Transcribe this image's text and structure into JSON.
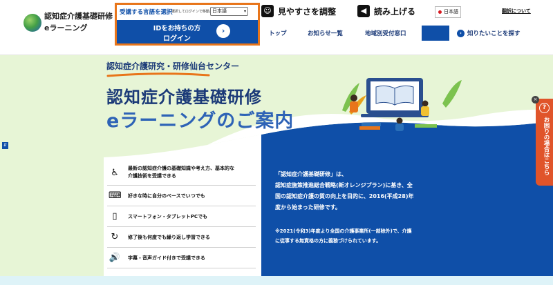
{
  "header": {
    "site_title_line1": "認知症介護基礎研修",
    "site_title_line2": "eラーニング",
    "login": {
      "language_label": "受講する言語を選択",
      "language_hint": "選択してログインで移動。",
      "language_value": "日本語",
      "button_line1": "IDをお持ちの方",
      "button_line2": "ログイン",
      "arrow_glyph": "›"
    },
    "tools": {
      "visibility_label": "見やすさを調整",
      "visibility_icon_glyph": "☺",
      "read_aloud_label": "読み上げる",
      "read_aloud_icon_glyph": "◀"
    },
    "language_badge": "日本語",
    "translate_link": "翻訳について"
  },
  "nav": {
    "items": [
      "トップ",
      "お知らせ一覧",
      "地域別受付窓口"
    ],
    "search_label": "知りたいことを探す",
    "search_icon_glyph": "›"
  },
  "hero": {
    "subtitle": "認知症介護研究・研修仙台センター",
    "title_line1": "認知症介護基礎研修",
    "title_line2": "eラーニングのご案内"
  },
  "features": [
    {
      "icon": "caregiver-icon",
      "glyph": "♿",
      "line1": "最新の認知症介護の基礎知識や考え方、基本的な",
      "line2": "介護技術を受講できる"
    },
    {
      "icon": "laptop-person-icon",
      "glyph": "⌨",
      "line1": "好きな時に自分のペースでいつでも",
      "line2": ""
    },
    {
      "icon": "smartphone-icon",
      "glyph": "▯",
      "line1": "スマートフォン・タブレットPCでも",
      "line2": ""
    },
    {
      "icon": "repeat-study-icon",
      "glyph": "↻",
      "line1": "修了後も何度でも繰り返し学習できる",
      "line2": ""
    },
    {
      "icon": "speaker-icon",
      "glyph": "🔊",
      "line1": "字幕・音声ガイド付きで受講できる",
      "line2": ""
    }
  ],
  "description": {
    "lines": [
      "「認知症介護基礎研修」は、",
      "認知症施策推進総合戦略(新オレンジプラン)に基き、全",
      "国の認知症介護の質の向上を目的に、2016(平成28)年",
      "度から始まった研修です。"
    ],
    "note_lines": [
      "※2021(令和3)年度より全国の介護事業所(一部除外)で、介護",
      "に従事する無資格の方に義務づけられています。"
    ]
  },
  "help_tab": {
    "text": "お困りの場合はこちら",
    "icon_glyph": "?",
    "close_glyph": "×"
  },
  "left_marker_glyph": "⇵",
  "colors": {
    "brand_blue": "#0f4fa8",
    "navy": "#1b3a78",
    "accent_orange": "#e8751a",
    "hero_green": "#e7f5d6",
    "help_orange": "#e0542a"
  }
}
